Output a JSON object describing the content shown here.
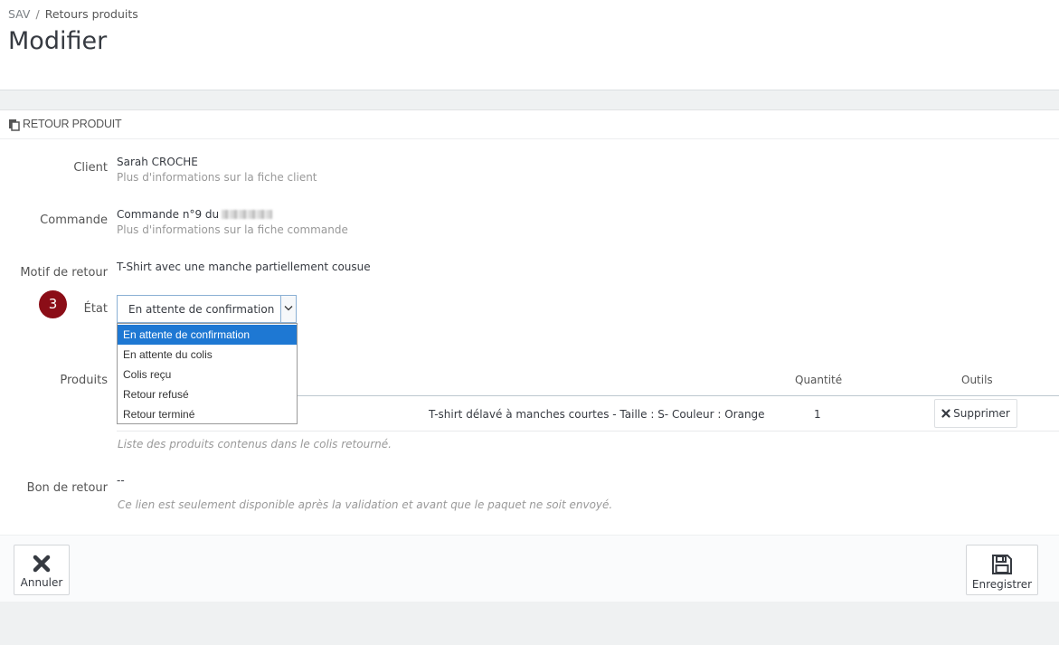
{
  "breadcrumb": {
    "root": "SAV",
    "separator": "/",
    "current": "Retours produits"
  },
  "page": {
    "title": "Modifier"
  },
  "panel": {
    "title": "RETOUR PRODUIT"
  },
  "fields": {
    "client": {
      "label": "Client",
      "value": "Sarah CROCHE",
      "hint": "Plus d'informations sur la fiche client"
    },
    "order": {
      "label": "Commande",
      "value": "Commande n°9 du",
      "hint": "Plus d'informations sur la fiche commande"
    },
    "reason": {
      "label": "Motif de retour",
      "value": "T-Shirt avec une manche partiellement cousue"
    },
    "status": {
      "label": "État",
      "step": "3",
      "selected": "En attente de confirmation",
      "options": [
        "En attente de confirmation",
        "En attente du colis",
        "Colis reçu",
        "Retour refusé",
        "Retour terminé"
      ]
    },
    "products": {
      "label": "Produits",
      "columns": {
        "quantity": "Quantité",
        "tools": "Outils"
      },
      "rows": [
        {
          "name": "T-shirt délavé à manches courtes - Taille : S- Couleur : Orange",
          "quantity": "1",
          "action": "Supprimer"
        }
      ],
      "help": "Liste des produits contenus dans le colis retourné."
    },
    "return_slip": {
      "label": "Bon de retour",
      "value": "--",
      "help": "Ce lien est seulement disponible après la validation et avant que le paquet ne soit envoyé."
    }
  },
  "footer": {
    "cancel_label": "Annuler",
    "save_label": "Enregistrer"
  },
  "colors": {
    "badge": "#8b0d17",
    "selected_option": "#1e78d3",
    "select_border": "#8ab0d4"
  },
  "icons": {
    "panel": "copy-icon",
    "delete": "times-icon",
    "cancel": "close-icon",
    "save": "floppy-disk-icon",
    "dropdown": "chevron-down-icon"
  }
}
